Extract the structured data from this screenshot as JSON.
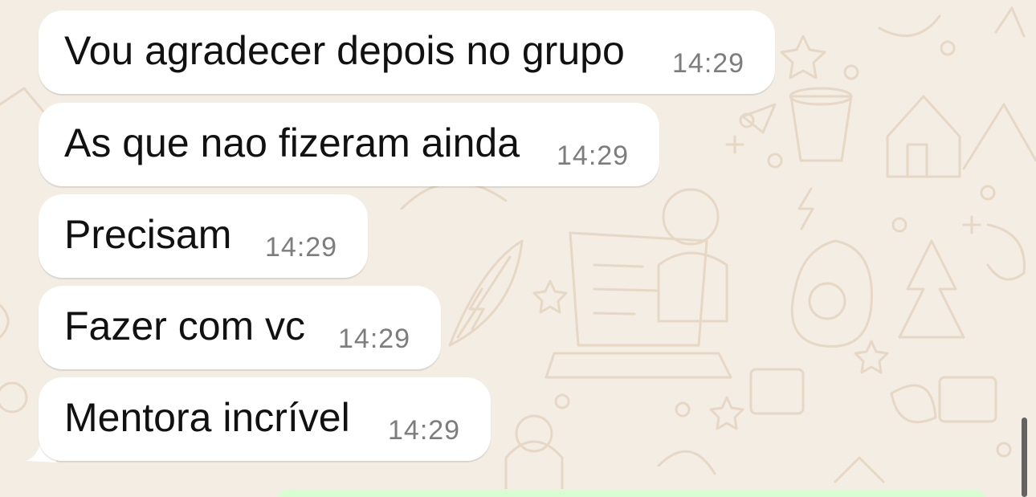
{
  "chat": {
    "messages": [
      {
        "text": "Vou agradecer depois no grupo",
        "time": "14:29"
      },
      {
        "text": "As que nao fizeram ainda",
        "time": "14:29"
      },
      {
        "text": "Precisam",
        "time": "14:29"
      },
      {
        "text": "Fazer com vc",
        "time": "14:29"
      },
      {
        "text": "Mentora incrível",
        "time": "14:29"
      }
    ]
  },
  "colors": {
    "background": "#f3ede3",
    "incoming_bubble": "#ffffff",
    "outgoing_bubble": "#d9fdd3",
    "timestamp": "#7d7d7d"
  },
  "icons": {
    "wallpaper": "doodle-pattern"
  }
}
